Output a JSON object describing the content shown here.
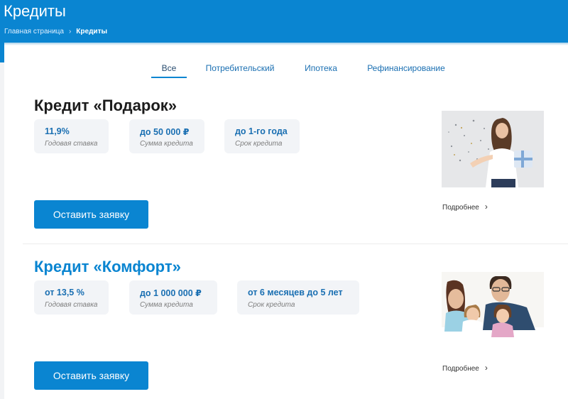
{
  "page": {
    "title": "Кредиты"
  },
  "breadcrumb": {
    "home": "Главная страница",
    "current": "Кредиты"
  },
  "tabs": [
    {
      "label": "Все",
      "active": true
    },
    {
      "label": "Потребительский",
      "active": false
    },
    {
      "label": "Ипотека",
      "active": false
    },
    {
      "label": "Рефинансирование",
      "active": false
    }
  ],
  "products": [
    {
      "title": "Кредит «Подарок»",
      "stats": [
        {
          "value": "11,9%",
          "caption": "Годовая ставка"
        },
        {
          "value": "до 50 000 ₽",
          "caption": "Сумма кредита"
        },
        {
          "value": "до 1-го года",
          "caption": "Срок кредита"
        }
      ],
      "button": "Оставить заявку",
      "more": "Подробнее",
      "image": "woman-with-gift-photo"
    },
    {
      "title": "Кредит «Комфорт»",
      "stats": [
        {
          "value": "от 13,5 %",
          "caption": "Годовая ставка"
        },
        {
          "value": "до 1 000 000 ₽",
          "caption": "Сумма кредита"
        },
        {
          "value": "от 6 месяцев до 5 лет",
          "caption": "Срок кредита"
        }
      ],
      "button": "Оставить заявку",
      "more": "Подробнее",
      "image": "family-photo"
    }
  ],
  "colors": {
    "brand": "#0a85d1",
    "stat_bg": "#f2f4f7"
  }
}
